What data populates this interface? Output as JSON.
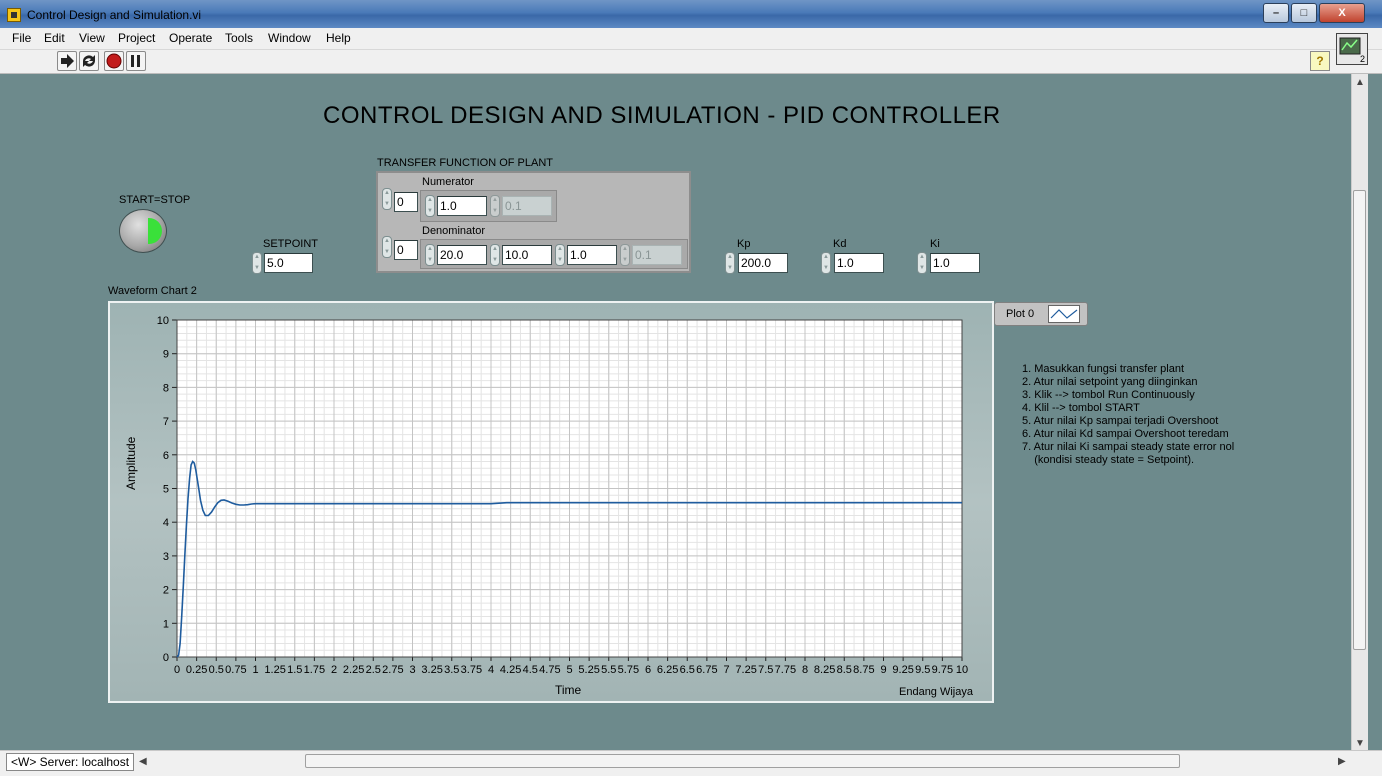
{
  "window": {
    "title": "Control Design and Simulation.vi",
    "controls": [
      "–",
      "□",
      "X"
    ]
  },
  "menu": [
    "File",
    "Edit",
    "View",
    "Project",
    "Operate",
    "Tools",
    "Window",
    "Help"
  ],
  "toolbar": {
    "help": "?",
    "icon_badge": "2"
  },
  "panel": {
    "main_title": "CONTROL DESIGN AND SIMULATION - PID CONTROLLER",
    "start": {
      "label": "START=STOP",
      "state": "off"
    },
    "setpoint": {
      "label": "SETPOINT",
      "value": "5.0"
    },
    "transfer": {
      "label": "TRANSFER FUNCTION OF PLANT",
      "numerator": {
        "label": "Numerator",
        "index": "0",
        "values": [
          "1.0"
        ],
        "next": "0.1"
      },
      "denominator": {
        "label": "Denominator",
        "index": "0",
        "values": [
          "20.0",
          "10.0",
          "1.0"
        ],
        "next": "0.1"
      }
    },
    "kp": {
      "label": "Kp",
      "value": "200.0"
    },
    "kd": {
      "label": "Kd",
      "value": "1.0"
    },
    "ki": {
      "label": "Ki",
      "value": "1.0"
    },
    "instructions": [
      "1. Masukkan fungsi transfer plant",
      "2. Atur nilai setpoint yang diinginkan",
      "3. Klik --> tombol Run Continuously",
      "4. Klil --> tombol START",
      "5. Atur nilai Kp sampai terjadi Overshoot",
      "6. Atur nilai Kd sampai Overshoot teredam",
      "7. Atur nilai Ki sampai steady state error nol",
      "    (kondisi steady state = Setpoint)."
    ]
  },
  "chart_data": {
    "type": "line",
    "title": "Waveform Chart 2",
    "xlabel": "Time",
    "ylabel": "Amplitude",
    "caption": "Endang Wijaya",
    "xlim": [
      0,
      10
    ],
    "ylim": [
      0,
      10
    ],
    "x_ticks": [
      "0",
      "0.25",
      "0.5",
      "0.75",
      "1",
      "1.25",
      "1.5",
      "1.75",
      "2",
      "2.25",
      "2.5",
      "2.75",
      "3",
      "3.25",
      "3.5",
      "3.75",
      "4",
      "4.25",
      "4.5",
      "4.75",
      "5",
      "5.25",
      "5.5",
      "5.75",
      "6",
      "6.25",
      "6.5",
      "6.75",
      "7",
      "7.25",
      "7.5",
      "7.75",
      "8",
      "8.25",
      "8.5",
      "8.75",
      "9",
      "9.25",
      "9.5",
      "9.75",
      "10"
    ],
    "y_ticks": [
      "0",
      "1",
      "2",
      "3",
      "4",
      "5",
      "6",
      "7",
      "8",
      "9",
      "10"
    ],
    "grid": true,
    "line_color": "#1f5c9e",
    "series": [
      {
        "name": "Plot 0",
        "x": [
          0,
          0.02,
          0.04,
          0.06,
          0.08,
          0.1,
          0.12,
          0.14,
          0.16,
          0.18,
          0.2,
          0.22,
          0.24,
          0.26,
          0.28,
          0.3,
          0.33,
          0.36,
          0.4,
          0.44,
          0.48,
          0.52,
          0.56,
          0.6,
          0.65,
          0.7,
          0.75,
          0.8,
          0.85,
          0.9,
          0.95,
          1.0,
          1.1,
          1.2,
          1.3,
          1.5,
          2.0,
          3.0,
          4.0,
          4.2,
          5.0,
          6.0,
          7.0,
          8.0,
          9.0,
          10.0
        ],
        "y": [
          0,
          0.05,
          0.4,
          1.2,
          2.1,
          3.0,
          3.9,
          4.7,
          5.3,
          5.7,
          5.8,
          5.75,
          5.55,
          5.25,
          4.95,
          4.65,
          4.35,
          4.2,
          4.2,
          4.3,
          4.45,
          4.58,
          4.65,
          4.66,
          4.62,
          4.57,
          4.53,
          4.51,
          4.51,
          4.52,
          4.54,
          4.55,
          4.55,
          4.55,
          4.55,
          4.55,
          4.55,
          4.55,
          4.55,
          4.58,
          4.58,
          4.58,
          4.58,
          4.58,
          4.58,
          4.58
        ]
      }
    ]
  },
  "status": {
    "server": "<W> Server: localhost"
  }
}
